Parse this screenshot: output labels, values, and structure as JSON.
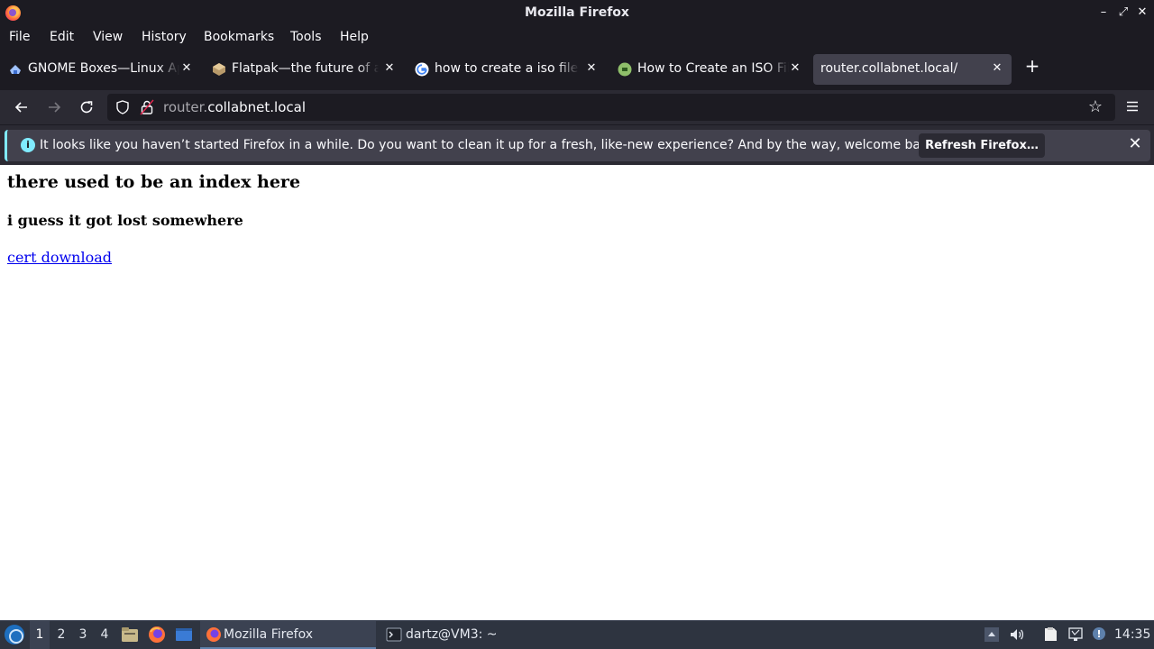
{
  "window": {
    "title": "Mozilla Firefox",
    "buttons": {
      "minimize": "–",
      "maximize": "⤢",
      "close": "✕"
    }
  },
  "menubar": {
    "items": [
      "File",
      "Edit",
      "View",
      "History",
      "Bookmarks",
      "Tools",
      "Help"
    ]
  },
  "tabs": [
    {
      "label": "GNOME Boxes—Linux Apps",
      "icon": "gnome-boxes-icon",
      "selected": false
    },
    {
      "label": "Flatpak—the future of apps",
      "icon": "flatpak-icon",
      "selected": false
    },
    {
      "label": "how to create a iso file in linux",
      "icon": "google-icon",
      "selected": false
    },
    {
      "label": "How to Create an ISO File",
      "icon": "site-favicon-icon",
      "selected": false
    },
    {
      "label": "router.collabnet.local/",
      "icon": "",
      "selected": true
    }
  ],
  "newtab_label": "+",
  "navbar": {
    "url_dim": "router.",
    "url_host": "collabnet.local"
  },
  "notification": {
    "message": "It looks like you haven’t started Firefox in a while. Do you want to clean it up for a fresh, like-new experience? And by the way, welcome back!",
    "button_label": "Refresh Firefox…",
    "info_glyph": "i",
    "close_glyph": "✕"
  },
  "page": {
    "heading": "there used to be an index here",
    "subheading": "i guess it got lost somewhere",
    "link": "cert download"
  },
  "taskbar": {
    "workspaces": [
      "1",
      "2",
      "3",
      "4"
    ],
    "active_workspace": "1",
    "tasks": [
      {
        "label": "Mozilla Firefox",
        "icon": "firefox-icon",
        "active": true
      },
      {
        "label": "dartz@VM3: ~",
        "icon": "terminal-icon",
        "active": false
      }
    ],
    "clock": "14:35"
  },
  "colors": {
    "chrome_dark": "#1c1b22",
    "chrome_mid": "#2b2a33",
    "tab_selected": "#42414d",
    "info_accent": "#80ebff",
    "link": "#0000ee",
    "taskbar": "#2e3440"
  }
}
